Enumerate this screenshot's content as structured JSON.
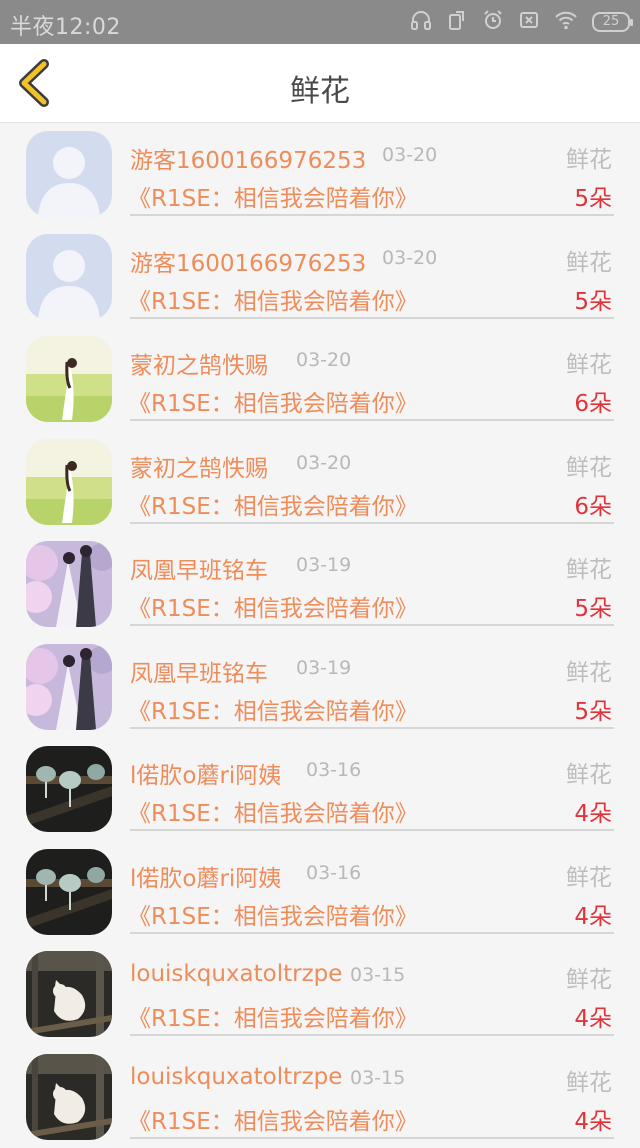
{
  "status_bar": {
    "time": "半夜12:02",
    "battery": "25"
  },
  "header": {
    "title": "鲜花"
  },
  "gift_records": [
    {
      "avatar": "default-avatar",
      "user": "游客1600166976253",
      "date": "03-20",
      "gift_type": "鲜花",
      "book": "《R1SE：相信我会陪着你》",
      "count": "5朵"
    },
    {
      "avatar": "default-avatar",
      "user": "游客1600166976253",
      "date": "03-20",
      "gift_type": "鲜花",
      "book": "《R1SE：相信我会陪着你》",
      "count": "5朵"
    },
    {
      "avatar": "girl-field-avatar",
      "user": "蒙初之鹄怢赐",
      "date": "03-20",
      "gift_type": "鲜花",
      "book": "《R1SE：相信我会陪着你》",
      "count": "6朵"
    },
    {
      "avatar": "girl-field-avatar",
      "user": "蒙初之鹄怢赐",
      "date": "03-20",
      "gift_type": "鲜花",
      "book": "《R1SE：相信我会陪着你》",
      "count": "6朵"
    },
    {
      "avatar": "couple-blossom-avatar",
      "user": "凤凰早班铭车",
      "date": "03-19",
      "gift_type": "鲜花",
      "book": "《R1SE：相信我会陪着你》",
      "count": "5朵"
    },
    {
      "avatar": "couple-blossom-avatar",
      "user": "凤凰早班铭车",
      "date": "03-19",
      "gift_type": "鲜花",
      "book": "《R1SE：相信我会陪着你》",
      "count": "5朵"
    },
    {
      "avatar": "wind-chime-avatar",
      "user": "l偌肷o蘑ri阿姨",
      "date": "03-16",
      "gift_type": "鲜花",
      "book": "《R1SE：相信我会陪着你》",
      "count": "4朵"
    },
    {
      "avatar": "wind-chime-avatar",
      "user": "l偌肷o蘑ri阿姨",
      "date": "03-16",
      "gift_type": "鲜花",
      "book": "《R1SE：相信我会陪着你》",
      "count": "4朵"
    },
    {
      "avatar": "cat-window-avatar",
      "user": "louiskquxatoltrzpe",
      "date": "03-15",
      "gift_type": "鲜花",
      "book": "《R1SE：相信我会陪着你》",
      "count": "4朵"
    },
    {
      "avatar": "cat-window-avatar",
      "user": "louiskquxatoltrzpe",
      "date": "03-15",
      "gift_type": "鲜花",
      "book": "《R1SE：相信我会陪着你》",
      "count": "4朵"
    }
  ]
}
